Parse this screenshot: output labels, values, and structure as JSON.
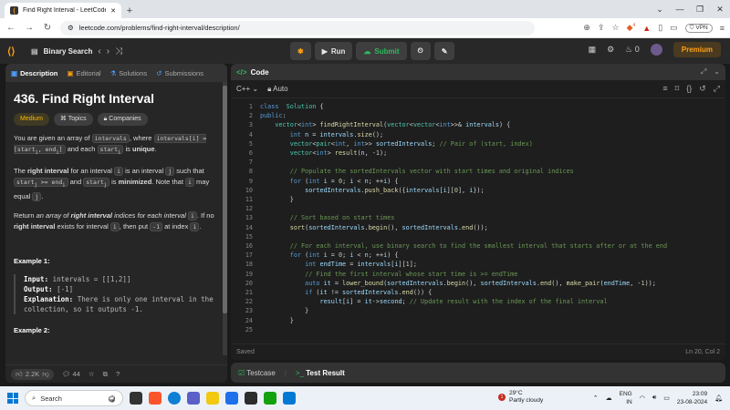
{
  "browser": {
    "tab_title": "Find Right Interval - LeetCode",
    "new_tab": "+",
    "url": "leetcode.com/problems/find-right-interval/description/",
    "vpn": "VPN",
    "vpn_icon": "shield-icon",
    "ext_badge": "4"
  },
  "header": {
    "problem_list": "Binary Search",
    "run": "Run",
    "submit": "Submit",
    "streak": "0",
    "premium": "Premium"
  },
  "left": {
    "tabs": [
      "Description",
      "Editorial",
      "Solutions",
      "Submissions"
    ],
    "title": "436. Find Right Interval",
    "difficulty": "Medium",
    "topics": "Topics",
    "companies": "Companies",
    "desc1_parts": [
      "You are given an array of ",
      "intervals",
      ", where ",
      "intervals[i] = [start",
      "i",
      ", end",
      "i",
      "]",
      " and each ",
      "start",
      "i",
      " is ",
      "unique",
      "."
    ],
    "desc2_parts": [
      "The ",
      "right interval",
      " for an interval ",
      "i",
      " is an interval ",
      "j",
      " such that ",
      "start",
      "j",
      " >= end",
      "i",
      " and ",
      "start",
      "j",
      " is ",
      "minimized",
      ". Note that ",
      "i",
      " may equal ",
      "j",
      "."
    ],
    "desc3_parts": [
      "Return ",
      "an array of ",
      "right interval",
      " indices for each interval ",
      "i",
      "",
      ". If no ",
      "right interval",
      " exists for interval ",
      "i",
      ", then put ",
      "-1",
      " at index ",
      "i",
      "."
    ],
    "example1_heading": "Example 1:",
    "example1_input_label": "Input:",
    "example1_input": " intervals = [[1,2]]",
    "example1_output_label": "Output:",
    "example1_output": " [-1]",
    "example1_expl_label": "Explanation:",
    "example1_expl": " There is only one interval in the collection, so it outputs -1.",
    "example2_heading": "Example 2:",
    "likes": "2.2K",
    "comments": "44"
  },
  "code": {
    "panel_title": "Code",
    "language": "C++",
    "auto": "Auto",
    "status_saved": "Saved",
    "cursor": "Ln 20, Col 2",
    "lines": [
      [
        [
          "kw",
          "class"
        ],
        [
          "",
          "  "
        ],
        [
          "tp",
          "Solution"
        ],
        [
          "",
          " {"
        ]
      ],
      [
        [
          "kw",
          "public"
        ],
        [
          "",
          ":"
        ]
      ],
      [
        [
          "",
          "    "
        ],
        [
          "tp",
          "vector"
        ],
        [
          "",
          "<"
        ],
        [
          "kw",
          "int"
        ],
        [
          "",
          "> "
        ],
        [
          "fn",
          "findRightInterval"
        ],
        [
          "",
          "("
        ],
        [
          "tp",
          "vector"
        ],
        [
          "",
          "<"
        ],
        [
          "tp",
          "vector"
        ],
        [
          "",
          "<"
        ],
        [
          "kw",
          "int"
        ],
        [
          "",
          ">>& "
        ],
        [
          "vr",
          "intervals"
        ],
        [
          "",
          ") {"
        ]
      ],
      [
        [
          "",
          "        "
        ],
        [
          "kw",
          "int"
        ],
        [
          "vr",
          " n"
        ],
        [
          "",
          " = "
        ],
        [
          "vr",
          "intervals"
        ],
        [
          "",
          "."
        ],
        [
          "fn",
          "size"
        ],
        [
          "",
          "();"
        ]
      ],
      [
        [
          "",
          "        "
        ],
        [
          "tp",
          "vector"
        ],
        [
          "",
          "<"
        ],
        [
          "tp",
          "pair"
        ],
        [
          "",
          "<"
        ],
        [
          "kw",
          "int"
        ],
        [
          "",
          ", "
        ],
        [
          "kw",
          "int"
        ],
        [
          "",
          ">> "
        ],
        [
          "vr",
          "sortedIntervals"
        ],
        [
          "",
          "; "
        ],
        [
          "cm",
          "// Pair of (start, index)"
        ]
      ],
      [
        [
          "",
          "        "
        ],
        [
          "tp",
          "vector"
        ],
        [
          "",
          "<"
        ],
        [
          "kw",
          "int"
        ],
        [
          "",
          "> "
        ],
        [
          "fn",
          "result"
        ],
        [
          "",
          "("
        ],
        [
          "vr",
          "n"
        ],
        [
          "",
          ", -"
        ],
        [
          "nm",
          "1"
        ],
        [
          "",
          ");"
        ]
      ],
      [
        [
          "",
          ""
        ]
      ],
      [
        [
          "",
          "        "
        ],
        [
          "cm",
          "// Populate the sortedIntervals vector with start times and original indices"
        ]
      ],
      [
        [
          "",
          "        "
        ],
        [
          "kw",
          "for"
        ],
        [
          "",
          " ("
        ],
        [
          "kw",
          "int"
        ],
        [
          "vr",
          " i"
        ],
        [
          "",
          " = "
        ],
        [
          "nm",
          "0"
        ],
        [
          "",
          "; "
        ],
        [
          "vr",
          "i"
        ],
        [
          "",
          " < "
        ],
        [
          "vr",
          "n"
        ],
        [
          "",
          "; ++"
        ],
        [
          "vr",
          "i"
        ],
        [
          "",
          ") {"
        ]
      ],
      [
        [
          "",
          "            "
        ],
        [
          "vr",
          "sortedIntervals"
        ],
        [
          "",
          "."
        ],
        [
          "fn",
          "push_back"
        ],
        [
          "",
          "({"
        ],
        [
          "vr",
          "intervals"
        ],
        [
          "",
          "["
        ],
        [
          "vr",
          "i"
        ],
        [
          "",
          "]["
        ],
        [
          "nm",
          "0"
        ],
        [
          "",
          "], "
        ],
        [
          "vr",
          "i"
        ],
        [
          "",
          "});"
        ]
      ],
      [
        [
          "",
          "        }"
        ]
      ],
      [
        [
          "",
          ""
        ]
      ],
      [
        [
          "",
          "        "
        ],
        [
          "cm",
          "// Sort based on start times"
        ]
      ],
      [
        [
          "",
          "        "
        ],
        [
          "fn",
          "sort"
        ],
        [
          "",
          "("
        ],
        [
          "vr",
          "sortedIntervals"
        ],
        [
          "",
          "."
        ],
        [
          "fn",
          "begin"
        ],
        [
          "",
          "(), "
        ],
        [
          "vr",
          "sortedIntervals"
        ],
        [
          "",
          "."
        ],
        [
          "fn",
          "end"
        ],
        [
          "",
          "());"
        ]
      ],
      [
        [
          "",
          ""
        ]
      ],
      [
        [
          "",
          "        "
        ],
        [
          "cm",
          "// For each interval, use binary search to find the smallest interval that starts after or at the end"
        ]
      ],
      [
        [
          "",
          "        "
        ],
        [
          "kw",
          "for"
        ],
        [
          "",
          " ("
        ],
        [
          "kw",
          "int"
        ],
        [
          "vr",
          " i"
        ],
        [
          "",
          " = "
        ],
        [
          "nm",
          "0"
        ],
        [
          "",
          "; "
        ],
        [
          "vr",
          "i"
        ],
        [
          "",
          " < "
        ],
        [
          "vr",
          "n"
        ],
        [
          "",
          "; ++"
        ],
        [
          "vr",
          "i"
        ],
        [
          "",
          ") {"
        ]
      ],
      [
        [
          "",
          "            "
        ],
        [
          "kw",
          "int"
        ],
        [
          "vr",
          " endTime"
        ],
        [
          "",
          " = "
        ],
        [
          "vr",
          "intervals"
        ],
        [
          "",
          "["
        ],
        [
          "vr",
          "i"
        ],
        [
          "",
          "]["
        ],
        [
          "nm",
          "1"
        ],
        [
          "",
          "];"
        ]
      ],
      [
        [
          "",
          "            "
        ],
        [
          "cm",
          "// Find the first interval whose start time is >= endTime"
        ]
      ],
      [
        [
          "",
          "            "
        ],
        [
          "kw",
          "auto"
        ],
        [
          "vr",
          " it"
        ],
        [
          "",
          " = "
        ],
        [
          "fn",
          "lower_bound"
        ],
        [
          "",
          "("
        ],
        [
          "vr",
          "sortedIntervals"
        ],
        [
          "",
          "."
        ],
        [
          "fn",
          "begin"
        ],
        [
          "",
          "(), "
        ],
        [
          "vr",
          "sortedIntervals"
        ],
        [
          "",
          "."
        ],
        [
          "fn",
          "end"
        ],
        [
          "",
          "(), "
        ],
        [
          "fn",
          "make_pair"
        ],
        [
          "",
          "("
        ],
        [
          "vr",
          "endTime"
        ],
        [
          "",
          ", -"
        ],
        [
          "nm",
          "1"
        ],
        [
          "",
          "));"
        ]
      ],
      [
        [
          "",
          "            "
        ],
        [
          "kw",
          "if"
        ],
        [
          "",
          " ("
        ],
        [
          "vr",
          "it"
        ],
        [
          "",
          " != "
        ],
        [
          "vr",
          "sortedIntervals"
        ],
        [
          "",
          "."
        ],
        [
          "fn",
          "end"
        ],
        [
          "",
          "()) {"
        ]
      ],
      [
        [
          "",
          "                "
        ],
        [
          "vr",
          "result"
        ],
        [
          "",
          "["
        ],
        [
          "vr",
          "i"
        ],
        [
          "",
          "] = "
        ],
        [
          "vr",
          "it"
        ],
        [
          "",
          "->"
        ],
        [
          "vr",
          "second"
        ],
        [
          "",
          "; "
        ],
        [
          "cm",
          "// Update result with the index of the final interval"
        ]
      ],
      [
        [
          "",
          "            }"
        ]
      ],
      [
        [
          "",
          "        }"
        ]
      ],
      [
        [
          "",
          ""
        ]
      ]
    ]
  },
  "bottom": {
    "testcase": "Testcase",
    "test_result": "Test Result"
  },
  "taskbar": {
    "search": "Search",
    "temp": "29°C",
    "weather": "Partly cloudy",
    "weather_badge": "1",
    "lang1": "ENG",
    "lang2": "IN",
    "time": "23:09",
    "date": "23-08-2024"
  }
}
